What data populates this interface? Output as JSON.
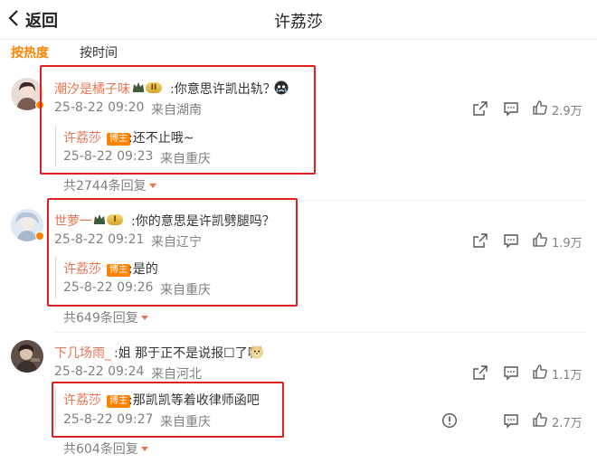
{
  "header": {
    "back_label": "返回",
    "title": "许荔莎"
  },
  "tabs": [
    {
      "label": "按热度",
      "active": true
    },
    {
      "label": "按时间",
      "active": false
    }
  ],
  "comments": [
    {
      "user": "潮汐是橘子味",
      "vip_level": "II",
      "text": ":你意思许凯出轨？",
      "emoji": "crying-face",
      "time": "25-8-22 09:20",
      "location": "来自湖南",
      "likes": "2.9万",
      "reply": {
        "user": "许荔莎",
        "badge": "博主",
        "text": ":还不止哦~",
        "time": "25-8-22 09:23",
        "location": "来自重庆"
      },
      "reply_count": "共2744条回复"
    },
    {
      "user": "世萝一",
      "vip_level": "I",
      "text": ":你的意思是许凯劈腿吗？",
      "time": "25-8-22 09:21",
      "location": "来自辽宁",
      "likes": "1.9万",
      "reply": {
        "user": "许荔莎",
        "badge": "博主",
        "text": ":是的",
        "time": "25-8-22 09:26",
        "location": "来自重庆"
      },
      "reply_count": "共649条回复"
    },
    {
      "user": "下几场雨_",
      "text": ":姐 那于正不是说报☐了嘛",
      "emoji": "doge-face",
      "time": "25-8-22 09:24",
      "location": "来自河北",
      "likes": "1.1万",
      "reply": {
        "user": "许荔莎",
        "badge": "博主",
        "text": ":那凯凯等着收律师函吧",
        "time": "25-8-22 09:27",
        "location": "来自重庆",
        "likes": "2.7万"
      },
      "reply_count": "共604条回复"
    }
  ],
  "colors": {
    "accent": "#ff8200",
    "nick": "#eb7350",
    "highlight_box": "#e02020",
    "meta": "#808080"
  }
}
